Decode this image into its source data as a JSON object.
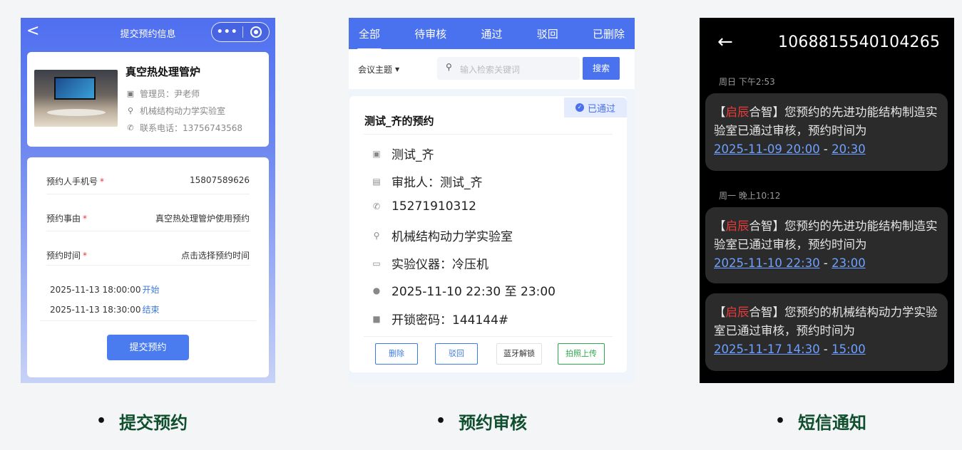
{
  "panel1": {
    "nav_back": "<",
    "nav_title": "提交预约信息",
    "capsule_dots": "•••",
    "lab": {
      "name": "真空热处理管炉",
      "manager": "管理员：尹老师",
      "location": "机械结构动力学实验室",
      "phone": "联系电话：13756743568"
    },
    "form": {
      "phone_label": "预约人手机号",
      "phone_value": "15807589626",
      "reason_label": "预约事由",
      "reason_value": "真空热处理管炉使用预约",
      "time_label": "预约时间",
      "time_value": "点击选择预约时间",
      "required_mark": "*",
      "start_time": "2025-11-13 18:00:00",
      "start_tag": "开始",
      "end_time": "2025-11-13 18:30:00",
      "end_tag": "结束",
      "submit_label": "提交预约"
    }
  },
  "panel2": {
    "tabs": [
      "全部",
      "待审核",
      "通过",
      "驳回",
      "已删除"
    ],
    "filter_label": "会议主题",
    "filter_caret": "▼",
    "search_placeholder": "输入检索关键词",
    "search_button": "搜索",
    "record": {
      "title": "测试_齐的预约",
      "status": "已通过",
      "user": "测试_齐",
      "approver": "审批人：测试_齐",
      "phone": "15271910312",
      "location": "机械结构动力学实验室",
      "instrument": "实验仪器：冷压机",
      "time": "2025-11-10 22:30 至 23:00",
      "password": "开锁密码：144144#"
    },
    "actions": [
      "删除",
      "驳回",
      "蓝牙解锁",
      "拍照上传"
    ]
  },
  "panel3": {
    "back": "←",
    "sender": "1068815540104265",
    "messages": [
      {
        "stamp": "周日 下午2:53",
        "lb": "【",
        "brand_red": "启辰",
        "brand_rest": "合智",
        "rb": "】",
        "body": "您预约的先进功能结构制造实验室已通过审核，预约时间为",
        "start": "2025-11-09 20:00",
        "dash": " - ",
        "end": "20:30"
      },
      {
        "stamp": "周一 晚上10:12",
        "lb": "【",
        "brand_red": "启辰",
        "brand_rest": "合智",
        "rb": "】",
        "body": "您预约的先进功能结构制造实验室已通过审核，预约时间为",
        "start": "2025-11-10 22:30",
        "dash": " - ",
        "end": "23:00"
      },
      {
        "stamp": "",
        "lb": "【",
        "brand_red": "启辰",
        "brand_rest": "合智",
        "rb": "】",
        "body": "您预约的机械结构动力学实验室已通过审核，预约时间为",
        "start": "2025-11-17 14:30",
        "dash": " - ",
        "end": "15:00"
      }
    ]
  },
  "captions": {
    "bullet": "•",
    "submit": "提交预约",
    "review": "预约审核",
    "sms": "短信通知"
  },
  "colors": {
    "primary_blue": "#4a72ee",
    "required_red": "#e53935",
    "brand_red": "#e83b3b",
    "link_blue": "#6da0ff",
    "caption_green": "#0f4f2e",
    "action_delete": "#3f7be5",
    "action_reject": "#3f7be5",
    "action_bluetooth": "#333333",
    "action_photo": "#2eaa4a"
  },
  "icons": {
    "manager": "id-card-icon",
    "location": "location-pin-icon",
    "phone": "phone-icon",
    "search": "magnifier-icon",
    "check": "check-circle-icon",
    "instrument": "monitor-icon",
    "clock": "clock-icon",
    "lock": "lock-icon",
    "approver": "document-icon",
    "more": "more-dots-icon",
    "close_mini": "target-circle-icon",
    "back": "back-arrow-icon"
  }
}
